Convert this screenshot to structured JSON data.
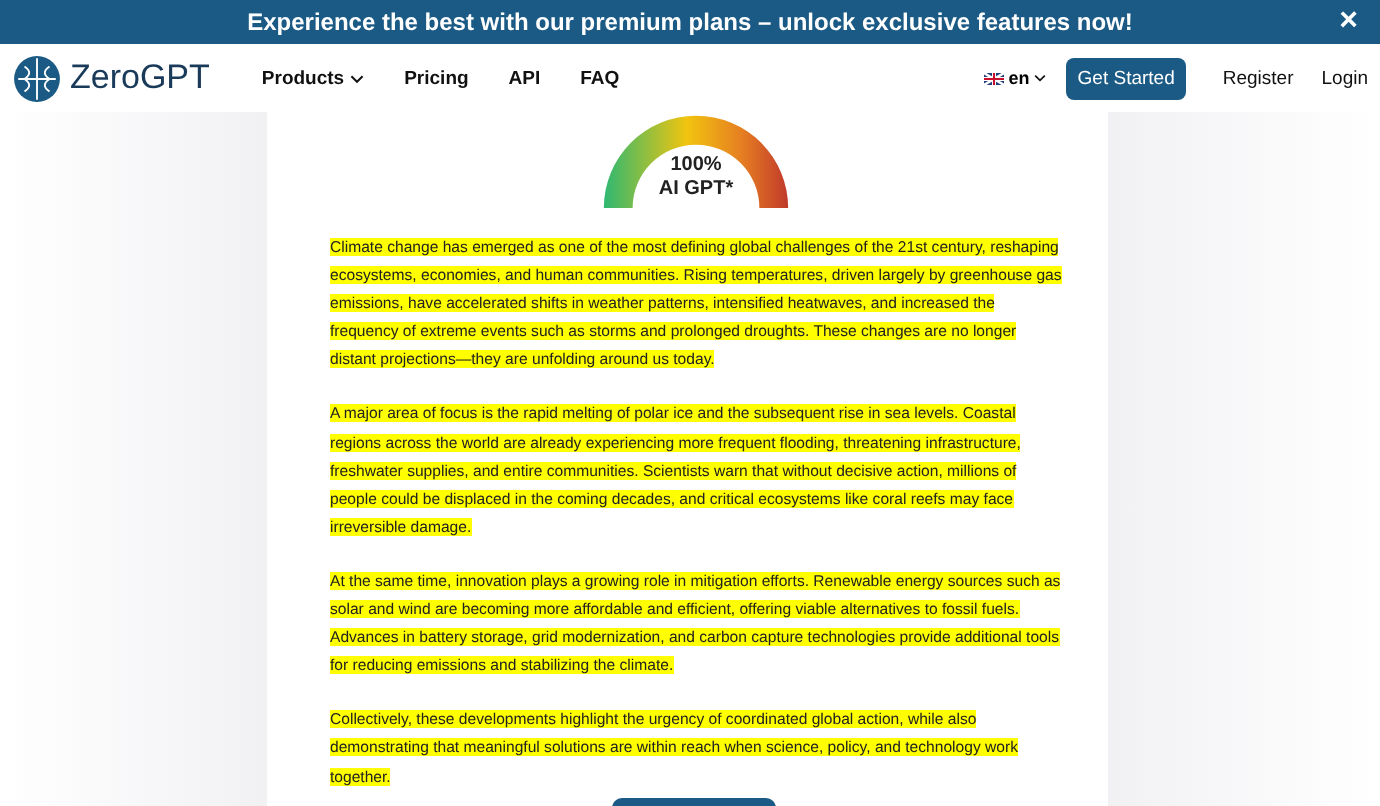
{
  "banner": {
    "text": "Experience the best with our premium plans – unlock exclusive features now!",
    "close": "×"
  },
  "nav": {
    "brand": "ZeroGPT",
    "links": [
      {
        "label": "Products",
        "dropdown": true
      },
      {
        "label": "Pricing",
        "dropdown": false
      },
      {
        "label": "API",
        "dropdown": false
      },
      {
        "label": "FAQ",
        "dropdown": false
      }
    ],
    "language": "en",
    "cta": "Get Started",
    "register": "Register",
    "login": "Login"
  },
  "gauge": {
    "percent": "100%",
    "label": "AI GPT*"
  },
  "paragraphs": [
    {
      "text": "Climate change has emerged as one of the most defining global challenges of the 21st century, reshaping ecosystems, economies, and human communities. Rising temperatures, driven largely by greenhouse gas emissions, have accelerated shifts in weather patterns, intensified heatwaves, and increased the frequency of extreme events such as storms and prolonged droughts. These changes are no longer distant projections—they are unfolding around us today.",
      "highlighted": true
    },
    {
      "text": "A major area of focus is the rapid melting of polar ice and the subsequent rise in sea levels. Coastal regions across the world are already experiencing more frequent flooding, threatening infrastructure, freshwater supplies, and entire communities. Scientists warn that without decisive action, millions of people could be displaced in the coming decades, and critical ecosystems like coral reefs may face irreversible damage.",
      "highlighted": true
    },
    {
      "text": "At the same time, innovation plays a growing role in mitigation efforts. Renewable energy sources such as solar and wind are becoming more affordable and efficient, offering viable alternatives to fossil fuels. Advances in battery storage, grid modernization, and carbon capture technologies provide additional tools for reducing emissions and stabilizing the climate.",
      "highlighted": true
    },
    {
      "text": "Collectively, these developments highlight the urgency of coordinated global action, while also demonstrating that meaningful solutions are within reach when science, policy, and technology work together.",
      "highlighted": true
    }
  ]
}
